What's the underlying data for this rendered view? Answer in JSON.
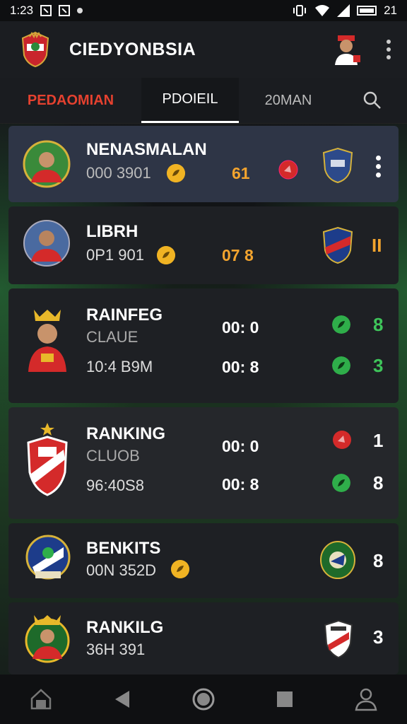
{
  "status_bar": {
    "time": "1:23",
    "right_text": "21"
  },
  "app_bar": {
    "title": "CIEDYONBSIA"
  },
  "tabs": [
    {
      "label": "PEDAOMIAN"
    },
    {
      "label": "PDOIEIL"
    },
    {
      "label": "20MAN"
    }
  ],
  "rows": [
    {
      "name": "NENASMALAN",
      "sub": "000 3901",
      "score": "61"
    },
    {
      "name": "LIBRH",
      "sub": "0P1 901",
      "score": "07 8",
      "right_value": "II"
    },
    {
      "name": "RAINFEG",
      "club": "CLAUE",
      "sub": "10:4 B9M",
      "score_1": "00: 0",
      "score_2": "00: 8",
      "value_1": "8",
      "value_2": "3"
    },
    {
      "name": "RANKING",
      "club": "CLUOB",
      "sub": "96:40S8",
      "score_1": "00: 0",
      "score_2": "00: 8",
      "value_1": "1",
      "value_2": "8"
    },
    {
      "name": "BENKITS",
      "sub": "00N 352D",
      "right_value": "8"
    },
    {
      "name": "RANKILG",
      "sub": "36H 391",
      "right_value": "3"
    }
  ],
  "colors": {
    "accent_red": "#e5412f",
    "accent_orange": "#f3a42e",
    "green": "#2fae4a",
    "active_card": "#2e3546"
  },
  "icons": [
    "house-icon",
    "back-icon",
    "home-circle-icon",
    "recents-icon",
    "person-icon",
    "search-icon",
    "more-vert-icon"
  ]
}
